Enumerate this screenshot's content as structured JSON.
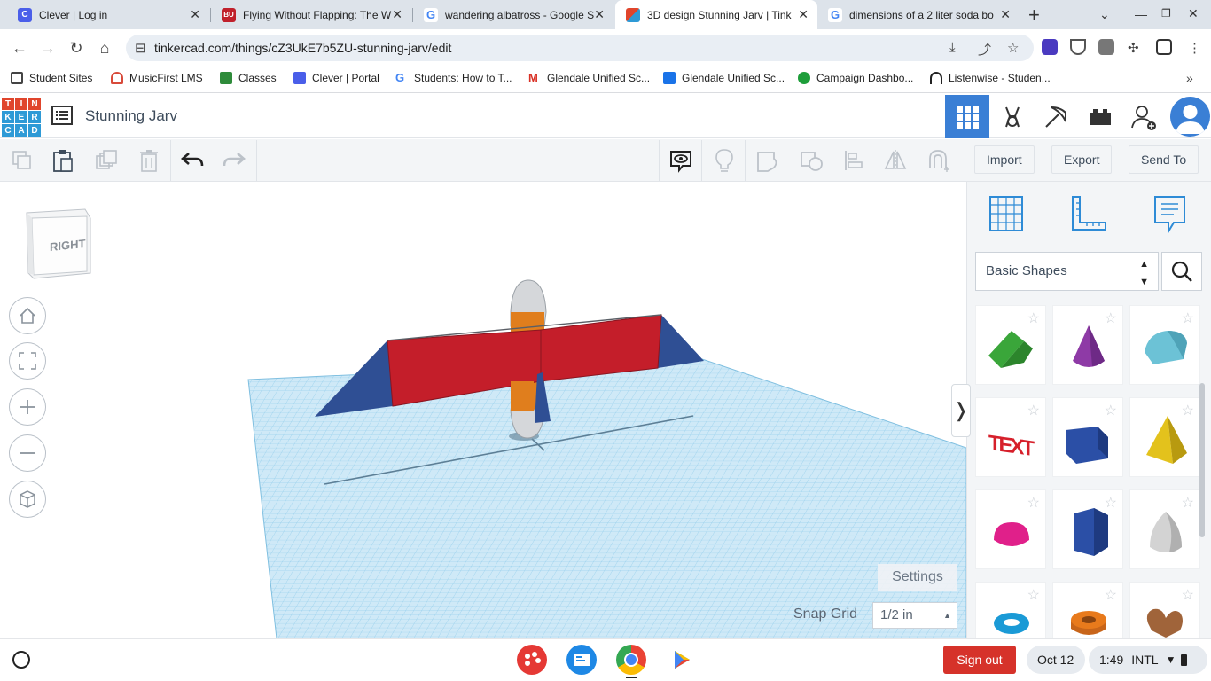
{
  "browser": {
    "tabs": [
      {
        "title": "Clever | Log in",
        "favicon": "C",
        "color": "#4a5ee9"
      },
      {
        "title": "Flying Without Flapping: The W",
        "favicon": "BU",
        "color": "#c0202b"
      },
      {
        "title": "wandering albatross - Google S",
        "favicon": "G",
        "color": "#ffffff"
      },
      {
        "title": "3D design Stunning Jarv | Tink",
        "favicon": "T",
        "color": "#ff6b35"
      },
      {
        "title": "dimensions of a 2 liter soda bo",
        "favicon": "G",
        "color": "#ffffff"
      }
    ],
    "url": "tinkercad.com/things/cZ3UkE7b5ZU-stunning-jarv/edit",
    "bookmarks": [
      {
        "label": "Student Sites",
        "icon": "folder-icon",
        "color": "#444444"
      },
      {
        "label": "MusicFirst LMS",
        "icon": "cloud-icon",
        "color": "#d84a3a"
      },
      {
        "label": "Classes",
        "icon": "classroom-icon",
        "color": "#2e8b3a"
      },
      {
        "label": "Clever | Portal",
        "icon": "clever-icon",
        "color": "#4a5ee9"
      },
      {
        "label": "Students: How to T...",
        "icon": "google-icon",
        "color": "#4285f4"
      },
      {
        "label": "Glendale Unified Sc...",
        "icon": "gmail-icon",
        "color": "#d93025"
      },
      {
        "label": "Glendale Unified Sc...",
        "icon": "calendar-icon",
        "color": "#1a73e8"
      },
      {
        "label": "Campaign Dashbo...",
        "icon": "clover-icon",
        "color": "#1e9e3a"
      },
      {
        "label": "Listenwise - Studen...",
        "icon": "headphones-icon",
        "color": "#222222"
      }
    ]
  },
  "tinkercad": {
    "logo": [
      "T",
      "I",
      "N",
      "K",
      "E",
      "R",
      "C",
      "A",
      "D"
    ],
    "logo_colors": [
      "#e0452c",
      "#e0452c",
      "#e0452c",
      "#2e9ad6",
      "#2e9ad6",
      "#2e9ad6",
      "#2e9ad6",
      "#2e9ad6",
      "#2e9ad6"
    ],
    "design_title": "Stunning Jarv",
    "toolbar": {
      "import_label": "Import",
      "export_label": "Export",
      "sendto_label": "Send To"
    },
    "view_cube_label": "RIGHT",
    "settings_label": "Settings",
    "snap_grid_label": "Snap Grid",
    "snap_grid_value": "1/2 in",
    "shape_category": "Basic Shapes",
    "shapes": [
      {
        "name": "Roof",
        "color": "#3aa63a"
      },
      {
        "name": "Cone",
        "color": "#8e3aa6"
      },
      {
        "name": "Round Roof",
        "color": "#6cc2d6"
      },
      {
        "name": "Text",
        "color": "#d6202b"
      },
      {
        "name": "Box",
        "color": "#2b4fa6"
      },
      {
        "name": "Pyramid",
        "color": "#e3c21c"
      },
      {
        "name": "Half Sphere",
        "color": "#e0208a"
      },
      {
        "name": "Polygon",
        "color": "#2b4fa6"
      },
      {
        "name": "Paraboloid",
        "color": "#cfcfcf"
      },
      {
        "name": "Torus",
        "color": "#1a9ad6"
      },
      {
        "name": "Tube",
        "color": "#e87a1c"
      },
      {
        "name": "Heart",
        "color": "#a0643a"
      }
    ]
  },
  "shelf": {
    "signout_label": "Sign out",
    "date": "Oct 12",
    "time": "1:49",
    "input_method": "INTL"
  }
}
